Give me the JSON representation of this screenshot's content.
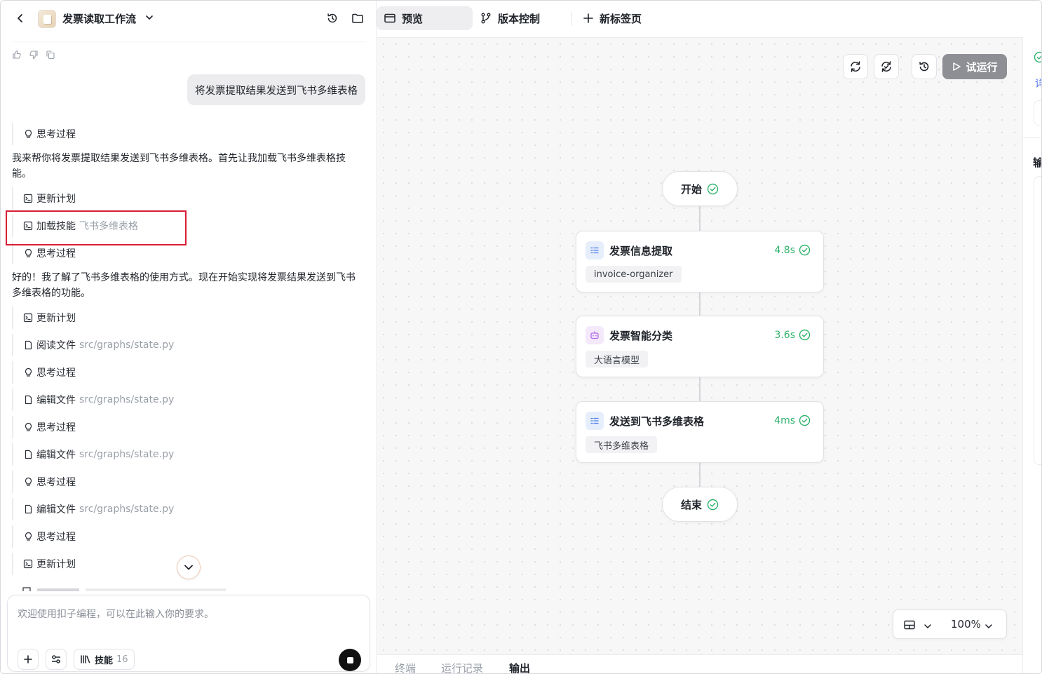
{
  "header": {
    "title": "发票读取工作流",
    "icons": [
      "back-chevron-icon",
      "history-icon",
      "folder-icon"
    ]
  },
  "chat": {
    "user_message": "将发票提取结果发送到飞书多维表格",
    "paragraph_1": "我来帮你将发票提取结果发送到飞书多维表格。首先让我加载飞书多维表格技能。",
    "paragraph_2": "好的！我了解了飞书多维表格的使用方式。现在开始实现将发票结果发送到飞书多维表格的功能。",
    "steps": [
      {
        "label": "思考过程",
        "sub": "",
        "icon": "bulb-icon"
      },
      {
        "label": "更新计划",
        "sub": "",
        "icon": "terminal-icon"
      },
      {
        "label": "加载技能",
        "sub": "飞书多维表格",
        "icon": "terminal-icon"
      },
      {
        "label": "思考过程",
        "sub": "",
        "icon": "bulb-icon"
      },
      {
        "label": "更新计划",
        "sub": "",
        "icon": "terminal-icon"
      },
      {
        "label": "阅读文件",
        "sub": "src/graphs/state.py",
        "icon": "file-icon"
      },
      {
        "label": "思考过程",
        "sub": "",
        "icon": "bulb-icon"
      },
      {
        "label": "编辑文件",
        "sub": "src/graphs/state.py",
        "icon": "file-icon"
      },
      {
        "label": "思考过程",
        "sub": "",
        "icon": "bulb-icon"
      },
      {
        "label": "编辑文件",
        "sub": "src/graphs/state.py",
        "icon": "file-icon"
      },
      {
        "label": "思考过程",
        "sub": "",
        "icon": "bulb-icon"
      },
      {
        "label": "编辑文件",
        "sub": "src/graphs/state.py",
        "icon": "file-icon"
      },
      {
        "label": "思考过程",
        "sub": "",
        "icon": "bulb-icon"
      },
      {
        "label": "更新计划",
        "sub": "",
        "icon": "terminal-icon"
      }
    ]
  },
  "composer": {
    "placeholder": "欢迎使用扣子编程，可以在此输入你的要求。",
    "skill_label": "技能",
    "skill_count": "16"
  },
  "tabs": [
    {
      "label": "预览",
      "icon": "preview-icon",
      "active": true
    },
    {
      "label": "版本控制",
      "icon": "branch-icon",
      "active": false
    },
    {
      "label": "新标签页",
      "icon": "plus-icon",
      "active": false
    }
  ],
  "canvas": {
    "run_label": "试运行",
    "start_label": "开始",
    "end_label": "结束",
    "nodes": [
      {
        "title": "发票信息提取",
        "time": "4.8s",
        "tag": "invoice-organizer",
        "icon": "list-icon",
        "accent": "#4e7ee8"
      },
      {
        "title": "发票智能分类",
        "time": "3.6s",
        "tag": "大语言模型",
        "icon": "robot-icon",
        "accent": "#b26be0"
      },
      {
        "title": "发送到飞书多维表格",
        "time": "4ms",
        "tag": "飞书多维表格",
        "icon": "list-icon",
        "accent": "#4e7ee8"
      }
    ],
    "zoom": "100%",
    "success_color": "#2fb36c"
  },
  "bottom_tabs": [
    {
      "label": "终端",
      "active": false
    },
    {
      "label": "运行记录",
      "active": false
    },
    {
      "label": "输出",
      "active": true
    }
  ],
  "right_strip": {
    "text_1": "详",
    "text_2": "输"
  }
}
